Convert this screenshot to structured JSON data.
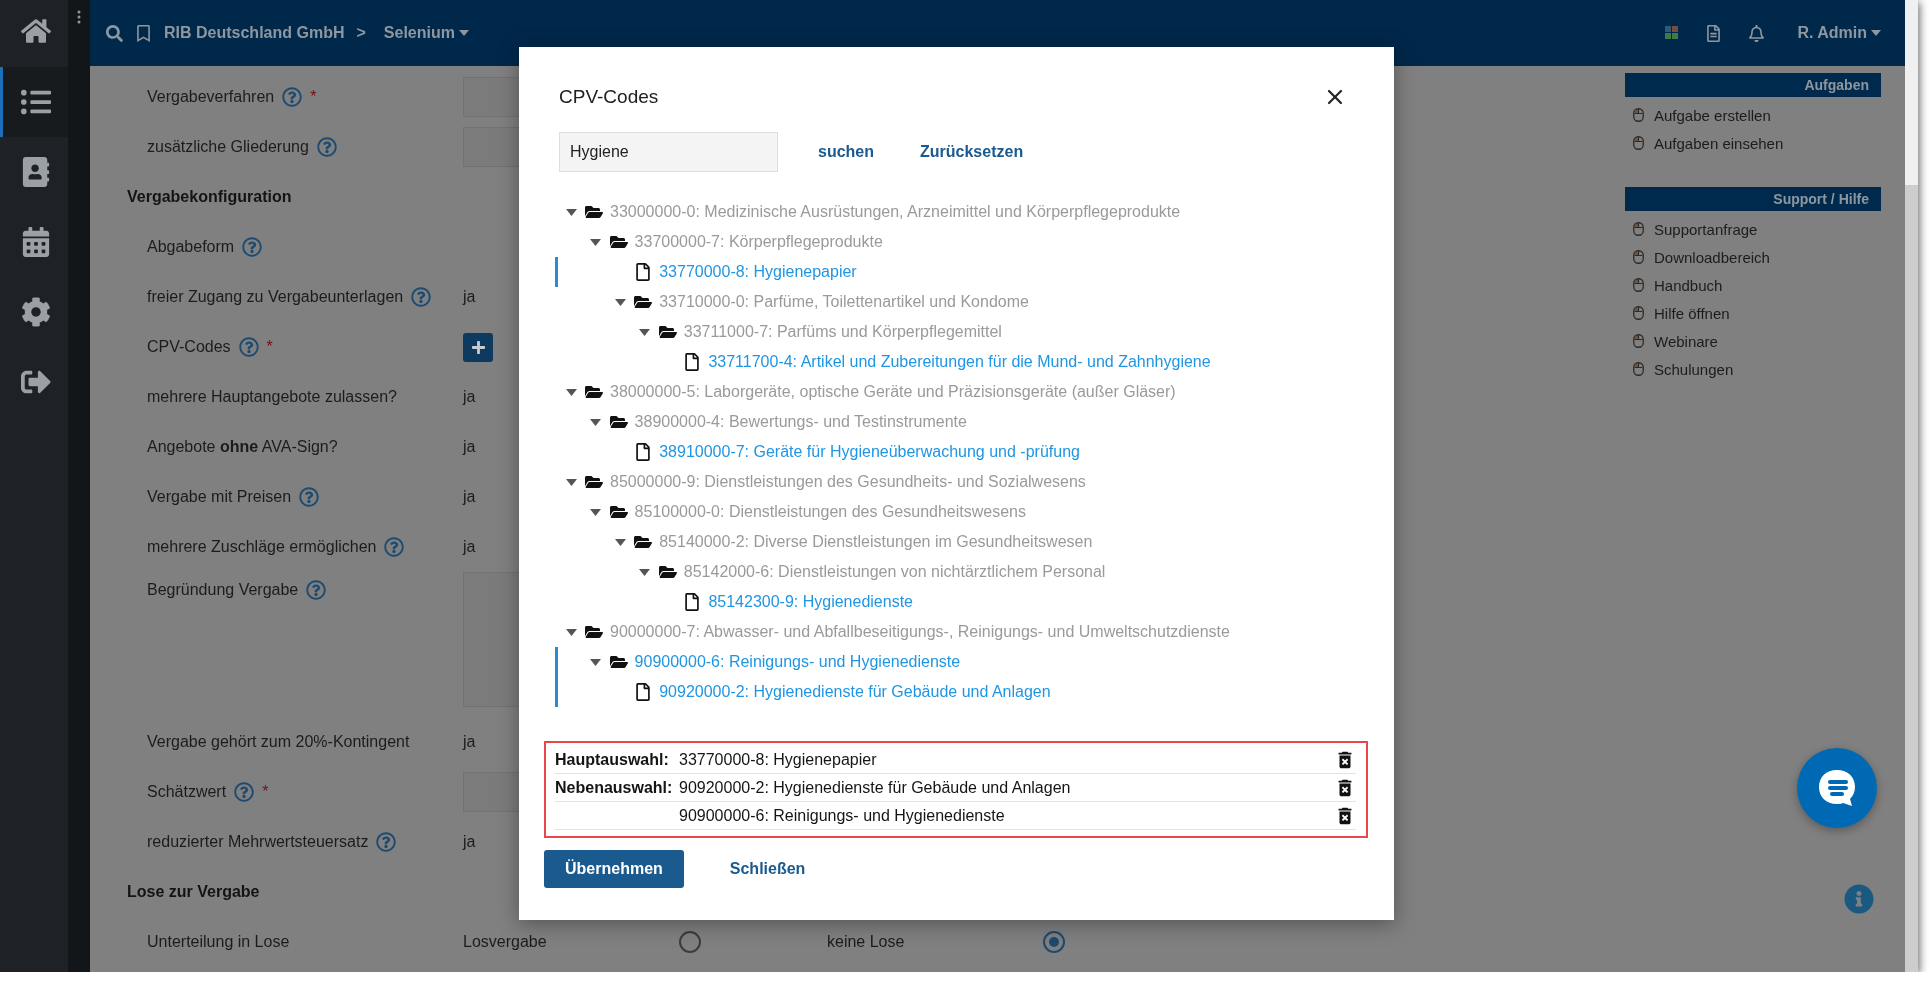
{
  "nav": [
    {
      "kind": "home",
      "selected": false
    },
    {
      "kind": "list",
      "selected": true
    },
    {
      "kind": "contacts",
      "selected": false
    },
    {
      "kind": "calendar",
      "selected": false
    },
    {
      "kind": "settings",
      "selected": false
    },
    {
      "kind": "logout",
      "selected": false
    }
  ],
  "top_bar": {
    "company": "RIB Deutschland GmbH",
    "separator": ">",
    "project": "Selenium",
    "user": "R. Admin"
  },
  "form": {
    "rows": [
      {
        "kind": "field",
        "label": "Vergabeverfahren",
        "help": true,
        "required_mark": "*",
        "control": {
          "kind": "input"
        }
      },
      {
        "kind": "field",
        "label": "zusätzliche Gliederung",
        "help": true,
        "control": {
          "kind": "input"
        }
      },
      {
        "kind": "heading",
        "label": "Vergabekonfiguration"
      },
      {
        "kind": "field",
        "label": "Abgabeform",
        "help": true,
        "control": {
          "kind": "none"
        }
      },
      {
        "kind": "field",
        "label": "freier Zugang zu Vergabeunterlagen",
        "help": true,
        "control": {
          "kind": "text",
          "value": "ja"
        }
      },
      {
        "kind": "field",
        "label": "CPV-Codes",
        "help": true,
        "required_mark": "*",
        "control": {
          "kind": "add_button"
        }
      },
      {
        "kind": "field",
        "label": "mehrere Hauptangebote zulassen?",
        "help": false,
        "control": {
          "kind": "text",
          "value": "ja"
        }
      },
      {
        "kind": "field",
        "label": "Angebote **ohne** AVA-Sign?",
        "help": false,
        "control": {
          "kind": "text",
          "value": "ja"
        }
      },
      {
        "kind": "field",
        "label": "Vergabe mit Preisen",
        "help": true,
        "control": {
          "kind": "text",
          "value": "ja"
        }
      },
      {
        "kind": "field",
        "label": "mehrere Zuschläge ermöglichen",
        "help": true,
        "control": {
          "kind": "text",
          "value": "ja"
        }
      },
      {
        "kind": "field",
        "label": "Begründung Vergabe",
        "help": true,
        "control": {
          "kind": "textarea"
        }
      },
      {
        "kind": "field",
        "label": "Vergabe gehört zum 20%-Kontingent",
        "help": false,
        "control": {
          "kind": "text",
          "value": "ja"
        }
      },
      {
        "kind": "field",
        "label": "Schätzwert",
        "help": true,
        "required_mark": "*",
        "control": {
          "kind": "input"
        }
      },
      {
        "kind": "field",
        "label": "reduzierter Mehrwertsteuersatz",
        "help": true,
        "control": {
          "kind": "text",
          "value": "ja"
        }
      },
      {
        "kind": "heading",
        "label": "Lose zur Vergabe"
      },
      {
        "kind": "field",
        "label": "Unterteilung in Lose",
        "help": false,
        "control": {
          "kind": "radios",
          "options": [
            {
              "label": "Losvergabe",
              "selected": false
            },
            {
              "label": "keine Lose",
              "selected": true
            }
          ]
        }
      }
    ]
  },
  "side_panel": {
    "sections": [
      {
        "title": "Aufgaben",
        "items": [
          "Aufgabe erstellen",
          "Aufgaben einsehen"
        ]
      },
      {
        "title": "Support / Hilfe",
        "items": [
          "Supportanfrage",
          "Downloadbereich",
          "Handbuch",
          "Hilfe öffnen",
          "Webinare",
          "Schulungen"
        ]
      }
    ]
  },
  "modal": {
    "title": "CPV-Codes",
    "search": {
      "value": "Hygiene"
    },
    "search_link": "suchen",
    "reset_link": "Zurücksetzen",
    "tree": [
      {
        "label": "33000000-0: Medizinische Ausrüstungen, Arzneimittel und Körperpflegeprodukte",
        "kind": "folder",
        "expanded": true,
        "match": false,
        "selected": false,
        "children": [
          {
            "label": "33700000-7: Körperpflegeprodukte",
            "kind": "folder",
            "expanded": true,
            "match": false,
            "selected": false,
            "children": [
              {
                "label": "33770000-8: Hygienepapier",
                "kind": "file",
                "match": true,
                "selected": true
              },
              {
                "label": "33710000-0: Parfüme, Toilettenartikel und Kondome",
                "kind": "folder",
                "expanded": true,
                "match": false,
                "selected": false,
                "children": [
                  {
                    "label": "33711000-7: Parfüms und Körperpflegemittel",
                    "kind": "folder",
                    "expanded": true,
                    "match": false,
                    "selected": false,
                    "children": [
                      {
                        "label": "33711700-4: Artikel und Zubereitungen für die Mund- und Zahnhygiene",
                        "kind": "file",
                        "match": true,
                        "selected": false
                      }
                    ]
                  }
                ]
              }
            ]
          }
        ]
      },
      {
        "label": "38000000-5: Laborgeräte, optische Geräte und Präzisionsgeräte (außer Gläser)",
        "kind": "folder",
        "expanded": true,
        "match": false,
        "selected": false,
        "children": [
          {
            "label": "38900000-4: Bewertungs- und Testinstrumente",
            "kind": "folder",
            "expanded": true,
            "match": false,
            "selected": false,
            "children": [
              {
                "label": "38910000-7: Geräte für Hygieneüberwachung und -prüfung",
                "kind": "file",
                "match": true,
                "selected": false
              }
            ]
          }
        ]
      },
      {
        "label": "85000000-9: Dienstleistungen des Gesundheits- und Sozialwesens",
        "kind": "folder",
        "expanded": true,
        "match": false,
        "selected": false,
        "children": [
          {
            "label": "85100000-0: Dienstleistungen des Gesundheitswesens",
            "kind": "folder",
            "expanded": true,
            "match": false,
            "selected": false,
            "children": [
              {
                "label": "85140000-2: Diverse Dienstleistungen im Gesundheitswesen",
                "kind": "folder",
                "expanded": true,
                "match": false,
                "selected": false,
                "children": [
                  {
                    "label": "85142000-6: Dienstleistungen von nichtärztlichem Personal",
                    "kind": "folder",
                    "expanded": true,
                    "match": false,
                    "selected": false,
                    "children": [
                      {
                        "label": "85142300-9: Hygienedienste",
                        "kind": "file",
                        "match": true,
                        "selected": false
                      }
                    ]
                  }
                ]
              }
            ]
          }
        ]
      },
      {
        "label": "90000000-7: Abwasser- und Abfallbeseitigungs-, Reinigungs- und Umweltschutzdienste",
        "kind": "folder",
        "expanded": true,
        "match": false,
        "selected": false,
        "children": [
          {
            "label": "90900000-6: Reinigungs- und Hygienedienste",
            "kind": "folder",
            "expanded": true,
            "match": true,
            "selected": true,
            "children": [
              {
                "label": "90920000-2: Hygienedienste für Gebäude und Anlagen",
                "kind": "file",
                "match": true,
                "selected": true
              }
            ]
          }
        ]
      }
    ],
    "selection": [
      {
        "label": "Hauptauswahl:",
        "value": "33770000-8: Hygienepapier"
      },
      {
        "label": "Nebenauswahl:",
        "value": "90920000-2: Hygienedienste für Gebäude und Anlagen"
      },
      {
        "value": "90900000-6: Reinigungs- und Hygienedienste"
      }
    ],
    "primary_button": "Übernehmen",
    "secondary_button": "Schließen"
  }
}
